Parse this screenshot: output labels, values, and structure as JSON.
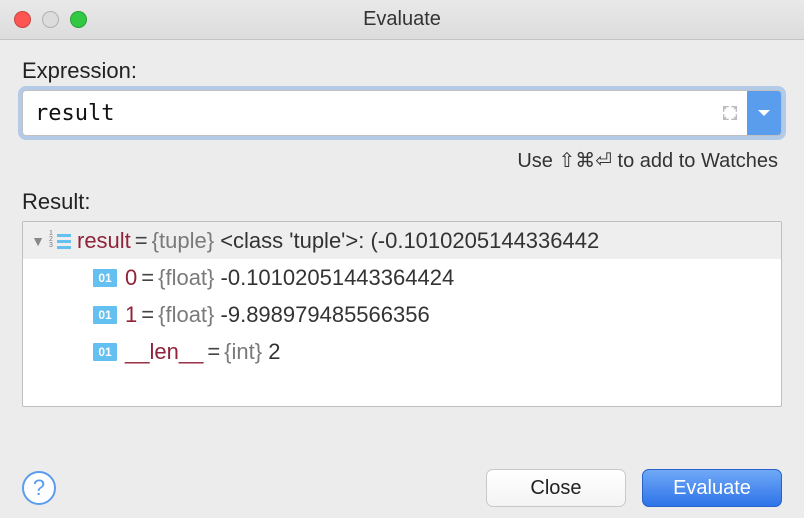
{
  "window": {
    "title": "Evaluate"
  },
  "labels": {
    "expression": "Expression:",
    "result": "Result:",
    "hint": "Use ⇧⌘⏎ to add to Watches"
  },
  "expression": {
    "value": "result"
  },
  "results": {
    "root": {
      "name": "result",
      "type": "{tuple}",
      "preview": "<class 'tuple'>: (-0.1010205144336442"
    },
    "children": [
      {
        "name": "0",
        "type": "{float}",
        "value": "-0.10102051443364424"
      },
      {
        "name": "1",
        "type": "{float}",
        "value": "-9.898979485566356"
      },
      {
        "name": "__len__",
        "type": "{int}",
        "value": "2"
      }
    ]
  },
  "buttons": {
    "close": "Close",
    "evaluate": "Evaluate"
  }
}
